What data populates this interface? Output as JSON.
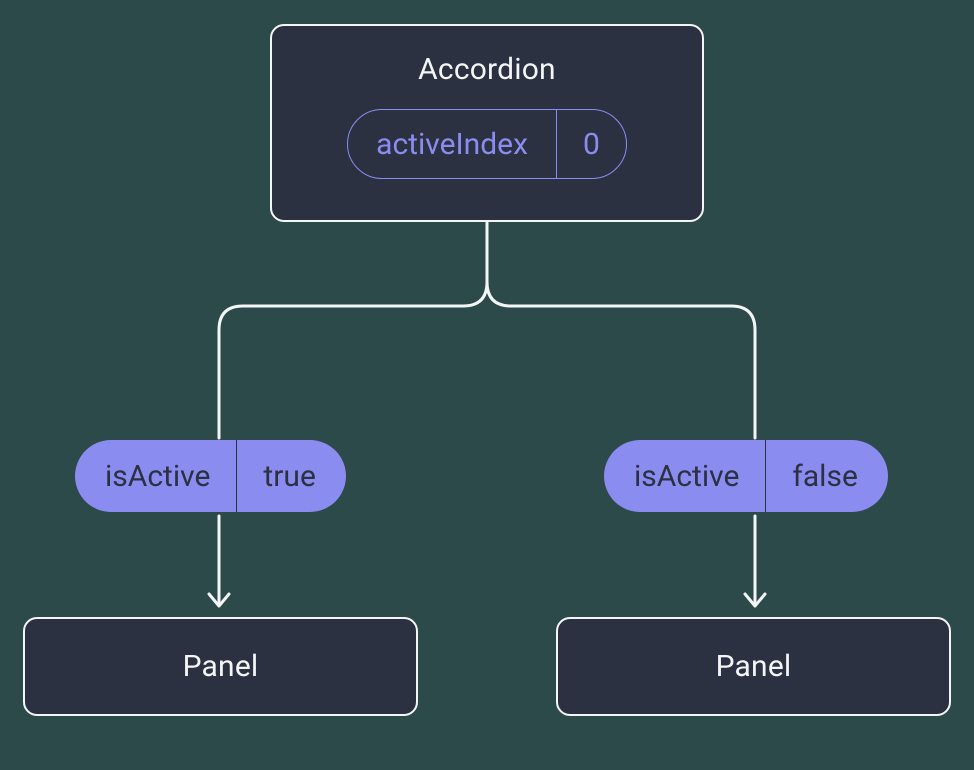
{
  "parent": {
    "title": "Accordion",
    "state": {
      "name": "activeIndex",
      "value": "0"
    }
  },
  "children": [
    {
      "prop": {
        "name": "isActive",
        "value": "true"
      },
      "panel": {
        "title": "Panel"
      }
    },
    {
      "prop": {
        "name": "isActive",
        "value": "false"
      },
      "panel": {
        "title": "Panel"
      }
    }
  ],
  "colors": {
    "bg": "#2d4a4a",
    "card": "#2b3140",
    "stroke": "#f4f5f6",
    "accent": "#8a8cf0"
  }
}
